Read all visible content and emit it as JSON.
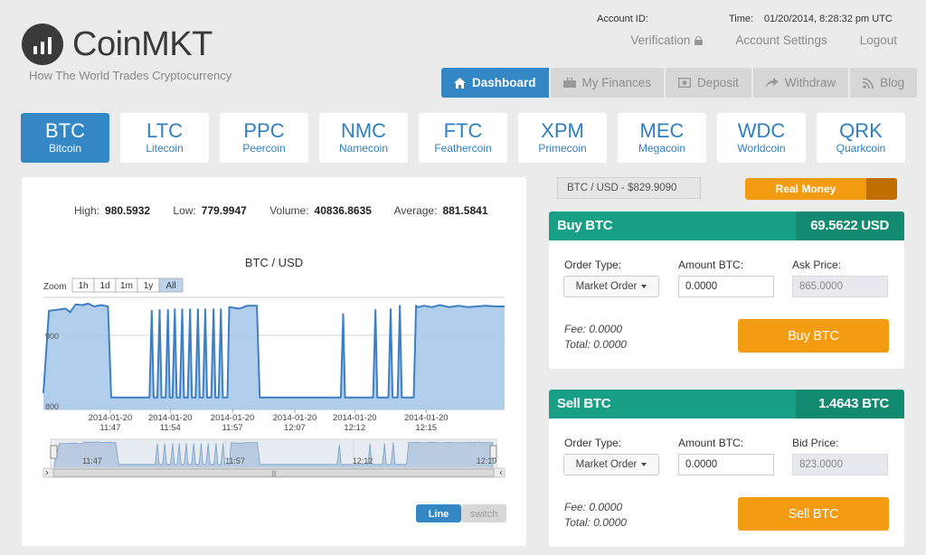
{
  "brand": {
    "name": "CoinMKT",
    "tagline": "How The World Trades Cryptocurrency"
  },
  "account": {
    "id_label": "Account ID:",
    "time_label": "Time:",
    "time_value": "01/20/2014, 8:28:32 pm UTC"
  },
  "top_links": {
    "verification": "Verification",
    "settings": "Account Settings",
    "logout": "Logout"
  },
  "nav": [
    {
      "label": "Dashboard",
      "icon": "home-icon",
      "active": true
    },
    {
      "label": "My Finances",
      "icon": "briefcase-icon"
    },
    {
      "label": "Deposit",
      "icon": "deposit-icon"
    },
    {
      "label": "Withdraw",
      "icon": "share-arrow-icon"
    },
    {
      "label": "Blog",
      "icon": "rss-icon"
    }
  ],
  "coins": [
    {
      "symbol": "BTC",
      "name": "Bitcoin",
      "active": true
    },
    {
      "symbol": "LTC",
      "name": "Litecoin"
    },
    {
      "symbol": "PPC",
      "name": "Peercoin"
    },
    {
      "symbol": "NMC",
      "name": "Namecoin"
    },
    {
      "symbol": "FTC",
      "name": "Feathercoin"
    },
    {
      "symbol": "XPM",
      "name": "Primecoin"
    },
    {
      "symbol": "MEC",
      "name": "Megacoin"
    },
    {
      "symbol": "WDC",
      "name": "Worldcoin"
    },
    {
      "symbol": "QRK",
      "name": "Quarkcoin"
    }
  ],
  "stats": {
    "high_label": "High:",
    "high": "980.5932",
    "low_label": "Low:",
    "low": "779.9947",
    "volume_label": "Volume:",
    "volume": "40836.8635",
    "avg_label": "Average:",
    "avg": "881.5841"
  },
  "chart": {
    "zoom_label": "Zoom",
    "zoom_buttons": [
      "1h",
      "1d",
      "1m",
      "1y",
      "All"
    ],
    "zoom_active": "All",
    "line_label": "Line",
    "switch_label": "switch",
    "nav_ticks": [
      "11:47",
      "11:57",
      "12:12",
      "12:19"
    ]
  },
  "chart_data": {
    "type": "area",
    "title": "BTC / USD",
    "xlabel": "",
    "ylabel": "",
    "ylim": [
      795,
      950
    ],
    "yticks": [
      800,
      900
    ],
    "xtick_labels": [
      [
        "2014-01-20",
        "11:47"
      ],
      [
        "2014-01-20",
        "11:54"
      ],
      [
        "2014-01-20",
        "11:57"
      ],
      [
        "2014-01-20",
        "12:07"
      ],
      [
        "2014-01-20",
        "12:12"
      ],
      [
        "2014-01-20",
        "12:15"
      ]
    ],
    "x_domain": [
      0,
      100
    ],
    "xtick_positions": [
      14.5,
      27.5,
      41.0,
      54.5,
      67.5,
      83.0
    ],
    "series": [
      {
        "values": [
          [
            0,
            818
          ],
          [
            1.2,
            935
          ],
          [
            2.8,
            936
          ],
          [
            4.8,
            938
          ],
          [
            5.8,
            933
          ],
          [
            7,
            944
          ],
          [
            8.5,
            943
          ],
          [
            9.7,
            945
          ],
          [
            11,
            941
          ],
          [
            12.5,
            943
          ],
          [
            14,
            941
          ],
          [
            14.7,
            812
          ],
          [
            20,
            812
          ],
          [
            23,
            812
          ],
          [
            23.5,
            935
          ],
          [
            23.9,
            812
          ],
          [
            24.7,
            812
          ],
          [
            25.2,
            936
          ],
          [
            25.6,
            812
          ],
          [
            26.5,
            812
          ],
          [
            27.0,
            936
          ],
          [
            27.4,
            812
          ],
          [
            28,
            812
          ],
          [
            28.5,
            937
          ],
          [
            28.9,
            812
          ],
          [
            29.6,
            812
          ],
          [
            30.1,
            937
          ],
          [
            30.5,
            812
          ],
          [
            31.3,
            812
          ],
          [
            31.8,
            937
          ],
          [
            32.2,
            812
          ],
          [
            33.0,
            812
          ],
          [
            33.5,
            937
          ],
          [
            33.9,
            812
          ],
          [
            34.6,
            812
          ],
          [
            35.1,
            937
          ],
          [
            35.5,
            812
          ],
          [
            36.4,
            812
          ],
          [
            36.9,
            937
          ],
          [
            37.3,
            812
          ],
          [
            38.0,
            812
          ],
          [
            38.5,
            937
          ],
          [
            38.9,
            812
          ],
          [
            39.9,
            812
          ],
          [
            40.3,
            940
          ],
          [
            42.5,
            938
          ],
          [
            44.2,
            942
          ],
          [
            46.3,
            942
          ],
          [
            46.9,
            812
          ],
          [
            55,
            812
          ],
          [
            63,
            812
          ],
          [
            64.5,
            812
          ],
          [
            65.0,
            930
          ],
          [
            65.4,
            812
          ],
          [
            71.5,
            812
          ],
          [
            72.0,
            936
          ],
          [
            72.4,
            812
          ],
          [
            74.8,
            812
          ],
          [
            75.3,
            937
          ],
          [
            75.7,
            812
          ],
          [
            76.8,
            812
          ],
          [
            77.3,
            942
          ],
          [
            77.7,
            812
          ],
          [
            80.3,
            812
          ],
          [
            80.8,
            942
          ],
          [
            81.2,
            940
          ],
          [
            82.5,
            942
          ],
          [
            84.2,
            940
          ],
          [
            86,
            943
          ],
          [
            88,
            940
          ],
          [
            90,
            942
          ],
          [
            92,
            940
          ],
          [
            94,
            941
          ],
          [
            96,
            942
          ],
          [
            98,
            941
          ],
          [
            100,
            941
          ]
        ]
      }
    ],
    "grid": "horizontal",
    "legend": "none"
  },
  "pair": {
    "label": "BTC / USD - $829.9090"
  },
  "mode": {
    "label": "Real Money"
  },
  "buy": {
    "title": "Buy BTC",
    "balance": "69.5622 USD",
    "order_type_label": "Order Type:",
    "order_type_value": "Market Order",
    "amount_label": "Amount BTC:",
    "amount_value": "0.0000",
    "price_label": "Ask Price:",
    "price_value": "865.0000",
    "fee": "Fee: 0.0000",
    "total": "Total: 0.0000",
    "button": "Buy BTC"
  },
  "sell": {
    "title": "Sell BTC",
    "balance": "1.4643 BTC",
    "order_type_label": "Order Type:",
    "order_type_value": "Market Order",
    "amount_label": "Amount BTC:",
    "amount_value": "0.0000",
    "price_label": "Bid Price:",
    "price_value": "823.0000",
    "fee": "Fee: 0.0000",
    "total": "Total: 0.0000",
    "button": "Sell BTC"
  },
  "colors": {
    "primary_blue": "#3387c5",
    "teal": "#17a085",
    "teal_dark": "#118a70",
    "orange": "#f39c12",
    "area_fill": "#a9c9ea",
    "line": "#3e7fc4"
  }
}
